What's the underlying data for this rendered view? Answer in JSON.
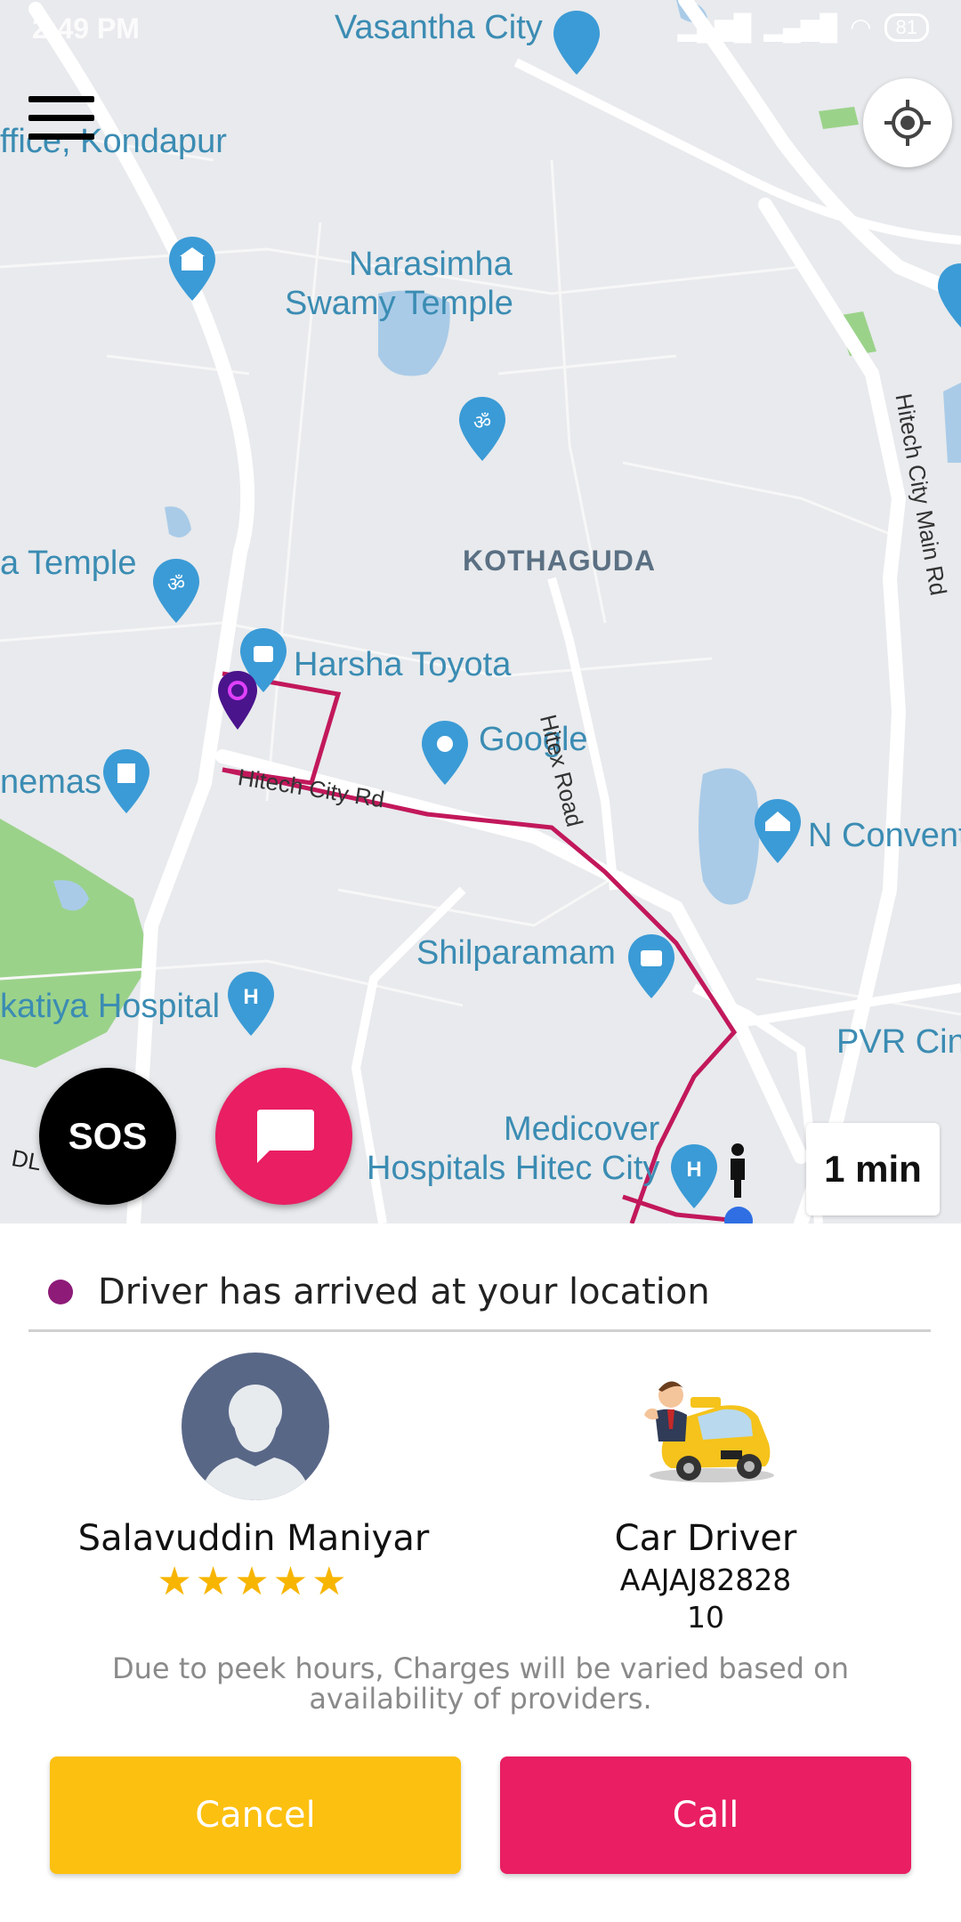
{
  "status_bar": {
    "time": "2:49 PM",
    "battery": "81"
  },
  "map": {
    "labels": {
      "vasantha": "Vasantha City",
      "office": "ffice, Kondapur",
      "narasimha_1": "Narasimha",
      "narasimha_2": "Swamy Temple",
      "kothaguda": "KOTHAGUDA",
      "temple": "a Temple",
      "harsha": "Harsha Toyota",
      "google": "Google",
      "hitex_road": "Hitex Road",
      "hitech_city_rd": "Hitech City Rd",
      "hitech_main": "Hitech City Main Rd",
      "cinemas": "nemas",
      "n_convent": "N Convent",
      "shilparamam": "Shilparamam",
      "hospital": "katiya Hospital",
      "pvr": "PVR Cin",
      "medicover_1": "Medicover",
      "medicover_2": "Hospitals Hitec City",
      "dl": "DL"
    }
  },
  "controls": {
    "sos": "SOS",
    "eta": "1 min"
  },
  "trip": {
    "status": "Driver has arrived at your location",
    "driver_name": "Salavuddin Maniyar",
    "rating": "★★★★★",
    "rating_value": 5,
    "car_type": "Car Driver",
    "car_plate": "AAJAJ82828",
    "car_number": "10",
    "note": "Due to peek hours, Charges will be varied based on availability of providers."
  },
  "buttons": {
    "cancel": "Cancel",
    "call": "Call"
  },
  "colors": {
    "accent": "#e91e63",
    "cancel": "#fcc010",
    "status_dot": "#8e1b78",
    "route": "#c2185b"
  }
}
